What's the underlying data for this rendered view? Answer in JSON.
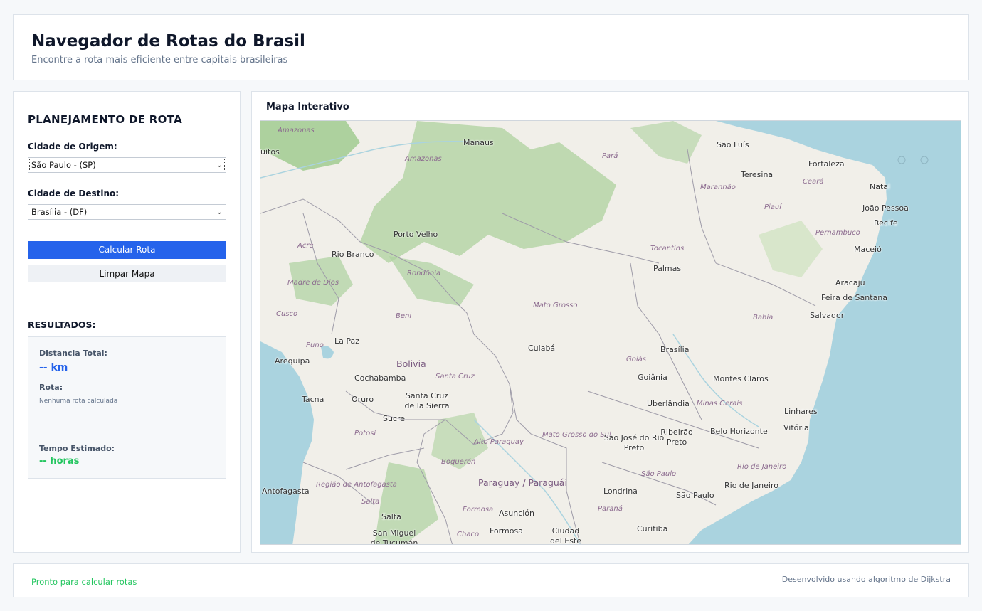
{
  "header": {
    "title": "Navegador de Rotas do Brasil",
    "subtitle": "Encontre a rota mais eficiente entre capitais brasileiras"
  },
  "sidebar": {
    "heading": "PLANEJAMENTO DE ROTA",
    "origin_label": "Cidade de Origem:",
    "origin_value": "São Paulo - (SP)",
    "dest_label": "Cidade de Destino:",
    "dest_value": "Brasília - (DF)",
    "calc_button": "Calcular Rota",
    "clear_button": "Limpar Mapa",
    "results_heading": "RESULTADOS:",
    "distance_label": "Distancia Total:",
    "distance_value": "-- km",
    "route_label": "Rota:",
    "route_value": "Nenhuma rota calculada",
    "time_label": "Tempo Estimado:",
    "time_value": "-- horas"
  },
  "map": {
    "title": "Mapa Interativo",
    "cities": [
      "Manaus",
      "São Luís",
      "Fortaleza",
      "Teresina",
      "Natal",
      "João Pessoa",
      "Recife",
      "Porto Velho",
      "Rio Branco",
      "Maceió",
      "Palmas",
      "Aracaju",
      "Feira de Santana",
      "Salvador",
      "Cuiabá",
      "Brasília",
      "Goiânia",
      "Montes Claros",
      "Uberlândia",
      "Linhares",
      "Vitória",
      "São José do Rio Preto",
      "Ribeirão Preto",
      "Belo Horizonte",
      "Rio de Janeiro",
      "Londrina",
      "São Paulo",
      "Curitiba",
      "La Paz",
      "Arequipa",
      "Cochabamba",
      "Santa Cruz de la Sierra",
      "Tacna",
      "Oruro",
      "Sucre",
      "Antofagasta",
      "Asunción",
      "Formosa",
      "Ciudad del Este",
      "Salta",
      "San Miguel de Tucumán",
      "uitos"
    ],
    "regions": [
      "Amazonas",
      "Pará",
      "Maranhão",
      "Ceará",
      "Piauí",
      "Pernambuco",
      "Acre",
      "Rondônia",
      "Tocantins",
      "Madre de Dios",
      "Mato Grosso",
      "Bahia",
      "Beni",
      "Cusco",
      "Puno",
      "Goiás",
      "Minas Gerais",
      "Santa Cruz",
      "Mato Grosso do Sul",
      "Alto Paraguay",
      "Potosí",
      "Boquerón",
      "São Paulo",
      "Rio de Janeiro",
      "Região de Antofagasta",
      "Formosa",
      "Paraná",
      "Chaco",
      "Salta"
    ],
    "countries": [
      "Bolivia",
      "Paraguay / Paraguái"
    ],
    "colors": {
      "land": "#f1efe9",
      "ocean": "#aad3df",
      "forest": "#add19e",
      "boundary": "#9e9ba8"
    }
  },
  "footer": {
    "status": "Pronto para calcular rotas",
    "credit": "Desenvolvido usando algoritmo de Dijkstra"
  },
  "colors": {
    "primary": "#2563eb",
    "success": "#22c55e"
  }
}
